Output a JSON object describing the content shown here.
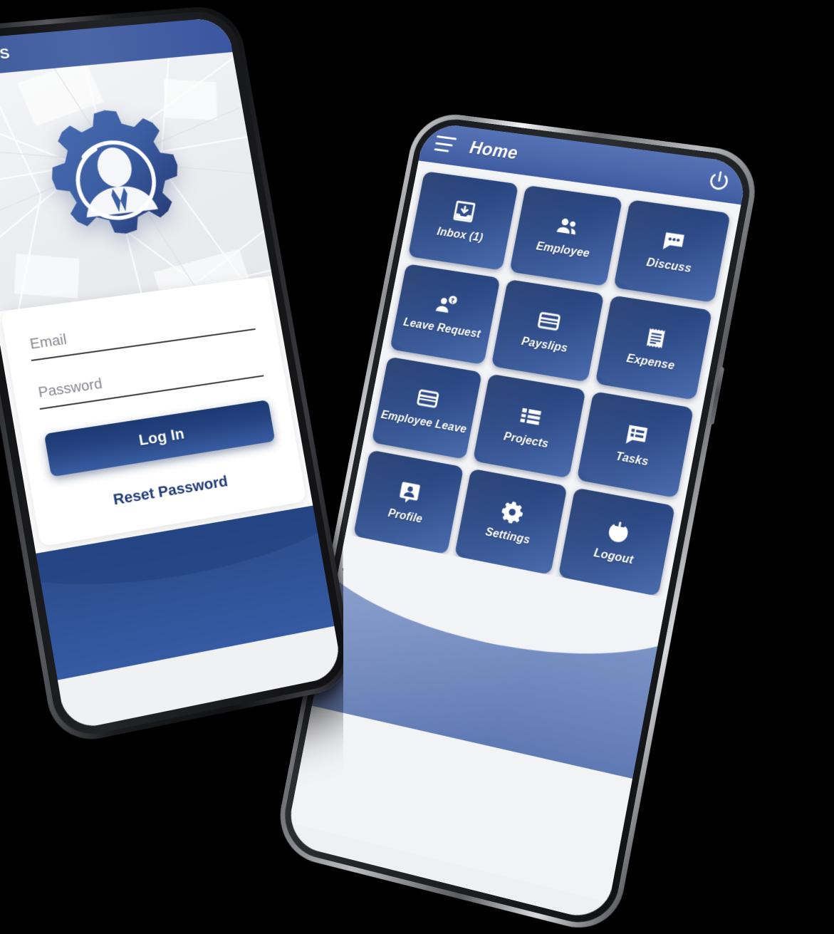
{
  "login_phone": {
    "appbar": {
      "title": "HRMS"
    },
    "logo": {
      "icon": "gear-person-logo"
    },
    "form": {
      "email": {
        "placeholder": "Email",
        "value": ""
      },
      "password": {
        "placeholder": "Password",
        "value": ""
      },
      "login_button": "Log In",
      "reset_link": "Reset Password"
    }
  },
  "home_phone": {
    "header": {
      "menu_icon": "hamburger-menu-icon",
      "title": "Home",
      "power_icon": "power-icon"
    },
    "tiles": [
      {
        "label": "Inbox (1)",
        "icon": "inbox-download-icon"
      },
      {
        "label": "Employee",
        "icon": "people-group-icon"
      },
      {
        "label": "Discuss",
        "icon": "chat-bubble-dots-icon"
      },
      {
        "label": "Leave Request",
        "icon": "person-question-icon"
      },
      {
        "label": "Payslips",
        "icon": "credit-card-icon"
      },
      {
        "label": "Expense",
        "icon": "receipt-icon"
      },
      {
        "label": "Employee Leave",
        "icon": "credit-card-icon"
      },
      {
        "label": "Projects",
        "icon": "list-blocks-icon"
      },
      {
        "label": "Tasks",
        "icon": "chat-list-icon"
      },
      {
        "label": "Profile",
        "icon": "contact-card-icon"
      },
      {
        "label": "Settings",
        "icon": "gear-icon"
      },
      {
        "label": "Logout",
        "icon": "power-icon"
      }
    ]
  },
  "colors": {
    "brand_blue": "#3f5ca2",
    "navy": "#1f3c77",
    "tile_dark": "#223a6e",
    "tile_light": "#4b6cae",
    "background": "#000000"
  }
}
